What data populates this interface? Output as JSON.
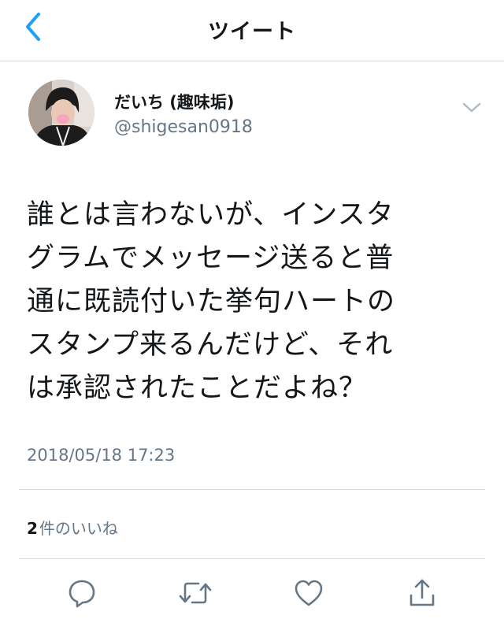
{
  "header": {
    "title": "ツイート",
    "back_icon": "chevron-left-icon",
    "accent_color": "#1da1f2"
  },
  "tweet": {
    "author": {
      "display_name": "だいち (趣味垢)",
      "handle": "@shigesan0918",
      "avatar_icon": "profile-photo"
    },
    "menu_icon": "chevron-down-icon",
    "text_lines": [
      "誰とは言わないが、インスタ",
      "グラムでメッセージ送ると普",
      "通に既読付いた挙句ハートの",
      "スタンプ来るんだけど、それ",
      "は承認されたことだよね？"
    ],
    "timestamp": "2018/05/18 17:23",
    "likes": {
      "count": "2",
      "label": "件のいいね"
    }
  },
  "actions": [
    {
      "name": "reply",
      "icon": "reply-icon"
    },
    {
      "name": "retweet",
      "icon": "retweet-icon"
    },
    {
      "name": "like",
      "icon": "heart-icon"
    },
    {
      "name": "share",
      "icon": "share-icon"
    }
  ],
  "colors": {
    "text": "#14171a",
    "secondary": "#657786",
    "icon": "#657786",
    "border": "#dcdcdc"
  }
}
